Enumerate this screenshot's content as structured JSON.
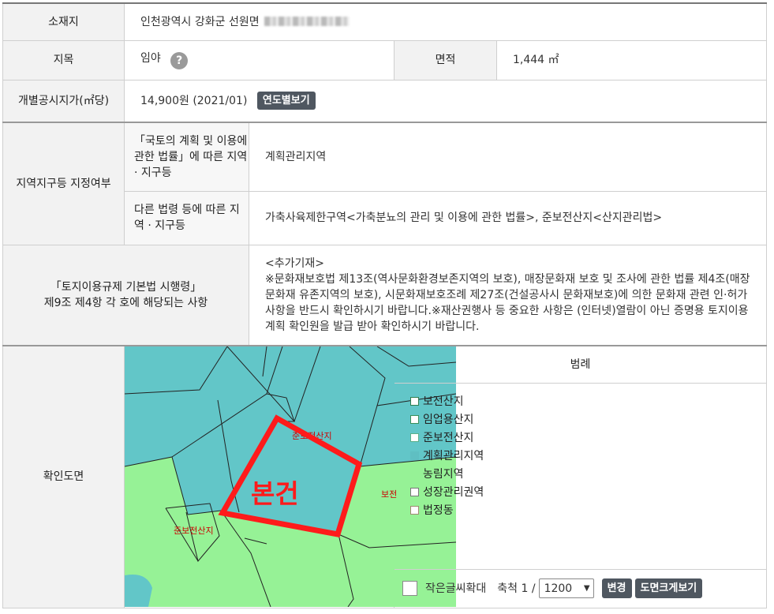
{
  "rows": {
    "location": {
      "label": "소재지",
      "value": "인천광역시 강화군 선원면"
    },
    "land_category": {
      "label": "지목",
      "value": "임야",
      "help_icon": "?",
      "area_label": "면적",
      "area_value": "1,444 ㎡"
    },
    "official_price": {
      "label": "개별공시지가(㎡당)",
      "value": "14,900원 (2021/01)",
      "button": "연도별보기"
    },
    "zoning": {
      "label": "지역지구등 지정여부",
      "sub1_label": "「국토의 계획 및 이용에 관한 법률」에 따른 지역 · 지구등",
      "sub1_value": "계획관리지역",
      "sub2_label": "다른 법령 등에 따른 지역 · 지구등",
      "sub2_value": "가축사육제한구역<가축분뇨의 관리 및 이용에 관한 법률>, 준보전산지<산지관리법>"
    },
    "regulation": {
      "label_line1": "「토지이용규제 기본법 시행령」",
      "label_line2": "제9조 제4항 각 호에 해당되는 사항",
      "note_title": "<추가기재>",
      "note_body": "※문화재보호법 제13조(역사문화환경보존지역의 보호), 매장문화재 보호 및 조사에 관한 법률 제4조(매장문화재 유존지역의 보호), 시문화재보호조례 제27조(건설공사시 문화재보호)에 의한 문화재 관련 인·허가 사항을 반드시 확인하시기 바랍니다.※재산권행사 등 중요한 사항은 (인터넷)열람이 아닌 증명용 토지이용계획 확인원을 발급 받아 확인하시기 바랍니다."
    },
    "map": {
      "label": "확인도면",
      "overlay_label": "본건",
      "map_text_1": "준보전산지",
      "map_text_2": "준보전산지",
      "map_text_3": "보전"
    }
  },
  "legend": {
    "title": "범례",
    "items": [
      {
        "label": "보전산지",
        "color": "#ffffff",
        "border": "#2f7d4f"
      },
      {
        "label": "임업용산지",
        "color": "#ffffff",
        "border": "#3a8f5a"
      },
      {
        "label": "준보전산지",
        "color": "#ffffff",
        "border": "#5bb08a"
      },
      {
        "label": "계획관리지역",
        "color": "#5fbfc2",
        "border": "#5fbfc2"
      },
      {
        "label": "농림지역",
        "color": "#96f296",
        "border": "#96f296"
      },
      {
        "label": "성장관리권역",
        "color": "#ffffff",
        "border": "#777777"
      },
      {
        "label": "법정동",
        "color": "#ffffff",
        "border": "#a08a70"
      }
    ],
    "enlarge_text_label": "작은글씨확대",
    "scale_prefix": "축척 1 /",
    "scale_value": "1200",
    "change_button": "변경",
    "big_map_button": "도면크게보기"
  },
  "colors": {
    "planned_management": "#62c6c8",
    "agricultural_forest": "#96f296",
    "parcel_outline": "#ff1b1b"
  }
}
